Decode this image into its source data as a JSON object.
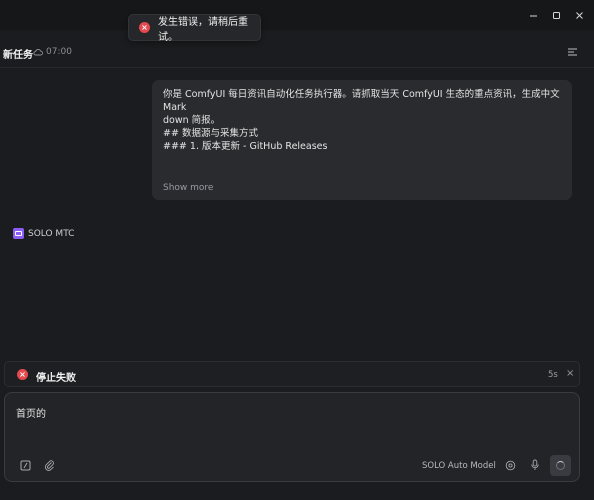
{
  "toast": {
    "message": "发生错误，请稍后重试。"
  },
  "header": {
    "title": "新任务",
    "time": "07:00"
  },
  "message": {
    "lines": [
      "你是 ComfyUI 每日资讯自动化任务执行器。请抓取当天 ComfyUI 生态的重点资讯，生成中文 Mark",
      "down 简报。",
      "",
      "## 数据源与采集方式",
      "",
      "### 1. 版本更新 - GitHub Releases"
    ],
    "show_more": "Show more"
  },
  "agent": {
    "name": "SOLO MTC"
  },
  "status": {
    "text": "停止失败",
    "elapsed": "5s"
  },
  "input": {
    "value": "首页的",
    "model": "SOLO Auto Model"
  },
  "colors": {
    "error": "#e5484d",
    "agent_badge": "#8b5cf6",
    "background": "#1b1c1f"
  }
}
